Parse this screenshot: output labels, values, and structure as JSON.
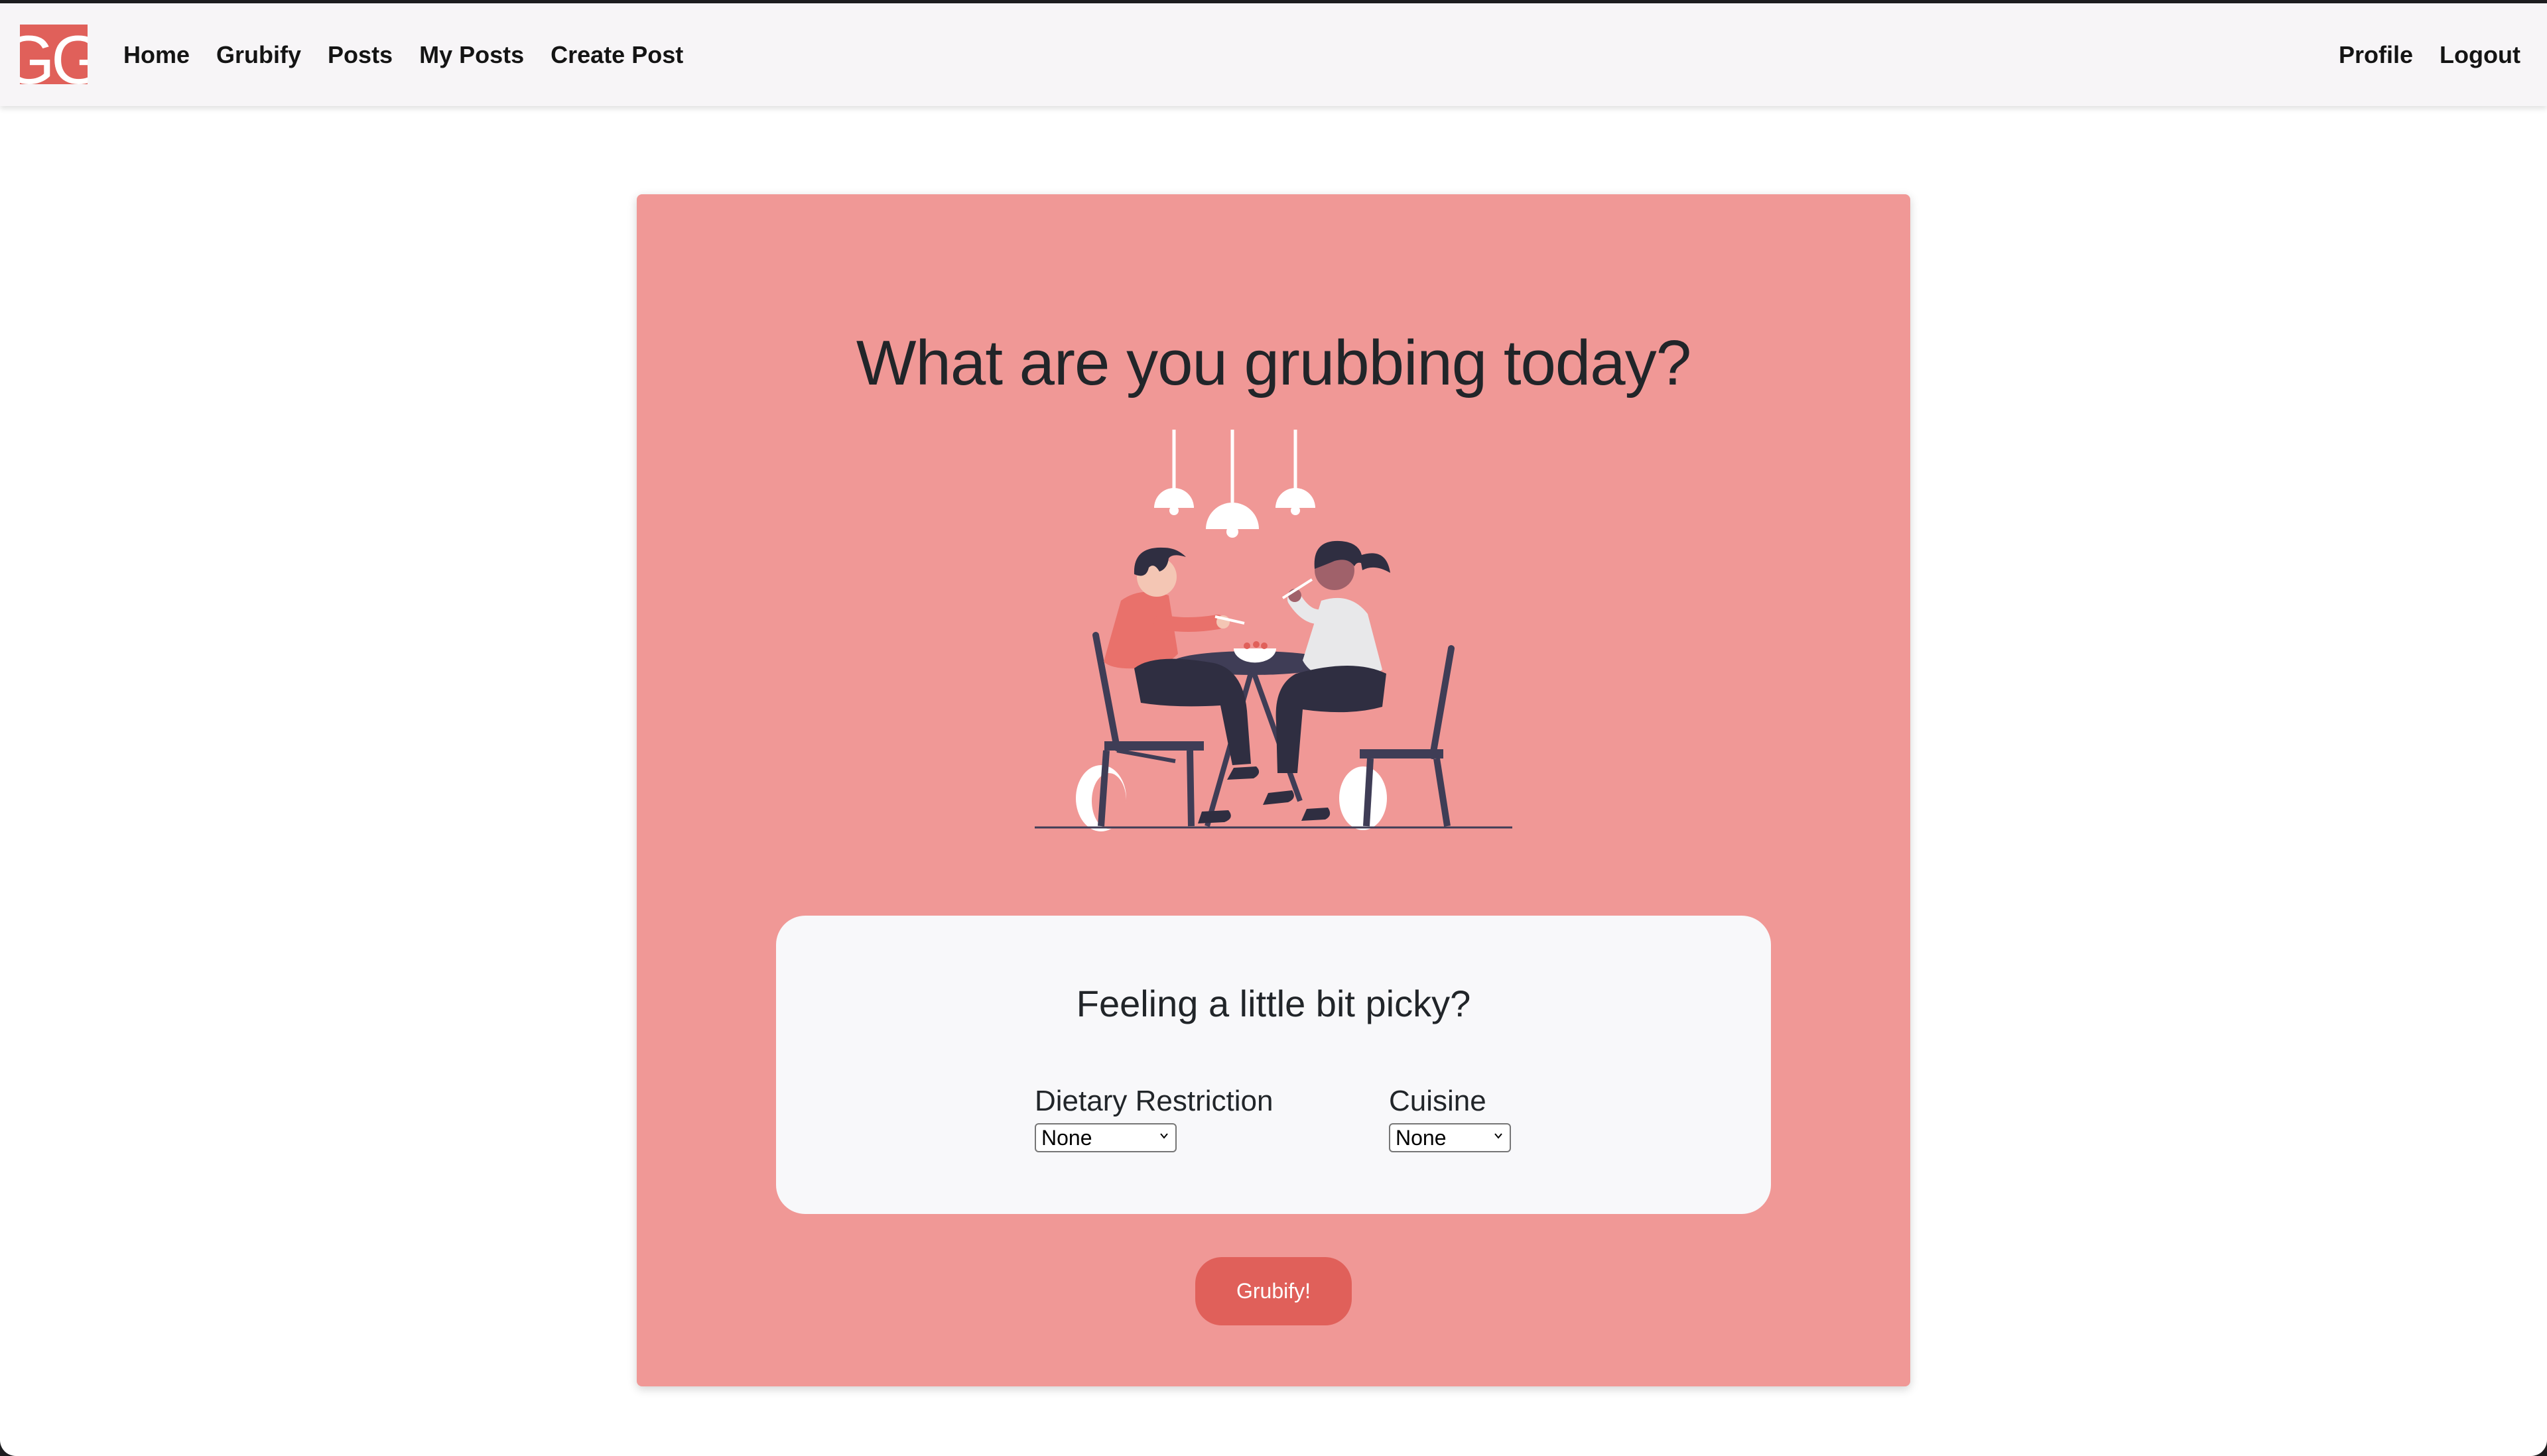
{
  "brand": {
    "logo_text": "GG",
    "accent_color": "#e0605a",
    "card_color": "#f09896"
  },
  "nav": {
    "left_items": [
      {
        "label": "Home"
      },
      {
        "label": "Grubify"
      },
      {
        "label": "Posts"
      },
      {
        "label": "My Posts"
      },
      {
        "label": "Create Post"
      }
    ],
    "right_items": [
      {
        "label": "Profile"
      },
      {
        "label": "Logout"
      }
    ]
  },
  "hero": {
    "heading": "What are you grubbing today?",
    "illustration_icon": "couple-dining-illustration"
  },
  "filters": {
    "title": "Feeling a little bit picky?",
    "dietary": {
      "label": "Dietary Restriction",
      "selected": "None"
    },
    "cuisine": {
      "label": "Cuisine",
      "selected": "None"
    }
  },
  "action": {
    "button_label": "Grubify!"
  }
}
